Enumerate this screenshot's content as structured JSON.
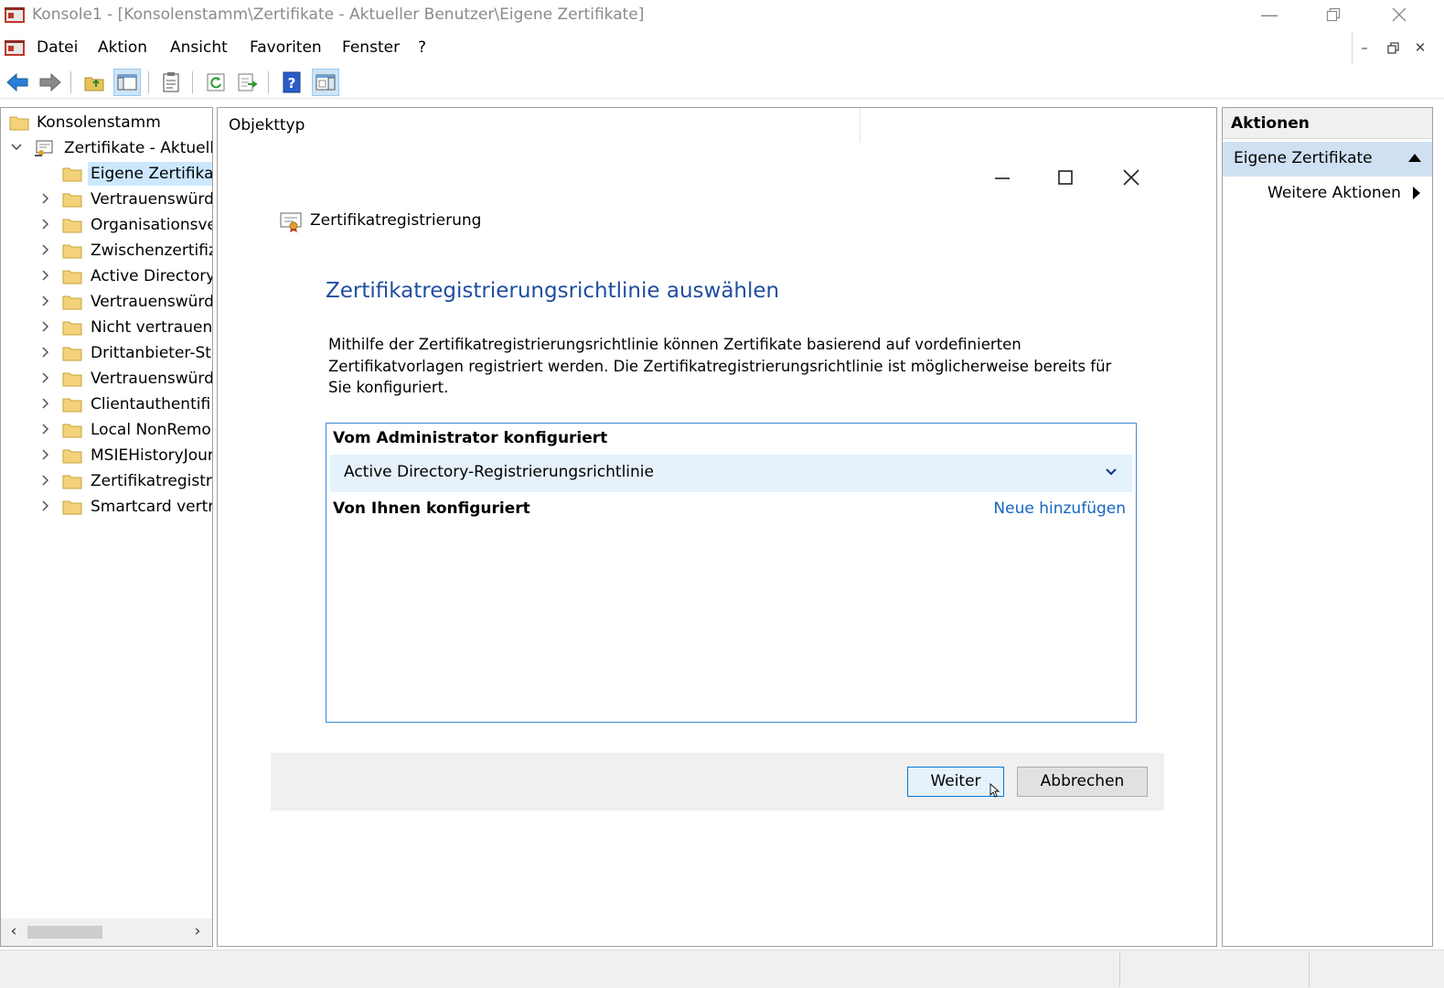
{
  "window": {
    "title": "Konsole1 - [Konsolenstamm\\Zertifikate - Aktueller Benutzer\\Eigene Zertifikate]"
  },
  "menu": {
    "items": [
      "Datei",
      "Aktion",
      "Ansicht",
      "Favoriten",
      "Fenster",
      "?"
    ]
  },
  "toolbar": {
    "buttons": [
      "back-arrow",
      "forward-arrow",
      "up-folder",
      "show-hide-tree",
      "properties",
      "refresh",
      "export-list",
      "help",
      "show-hide-action-pane"
    ]
  },
  "tree": {
    "root": "Konsolenstamm",
    "store": "Zertifikate - Aktuell",
    "items": [
      "Eigene Zertifikat",
      "Vertrauenswürdi",
      "Organisationsve",
      "Zwischenzertifiz",
      "Active Directory",
      "Vertrauenswürdi",
      "Nicht vertrauens",
      "Drittanbieter-Sta",
      "Vertrauenswürdi",
      "Clientauthentifi",
      "Local NonRemo",
      "MSIEHistoryJour",
      "Zertifikatregistri",
      "Smartcard vertra"
    ],
    "selected_index": 0
  },
  "center": {
    "column_header": "Objekttyp"
  },
  "wizard": {
    "title": "Zertifikatregistrierung",
    "heading": "Zertifikatregistrierungsrichtlinie auswählen",
    "description": "Mithilfe der Zertifikatregistrierungsrichtlinie können Zertifikate basierend auf vordefinierten Zertifikatvorlagen registriert werden. Die Zertifikatregistrierungsrichtlinie ist möglicherweise bereits für Sie konfiguriert.",
    "admin_configured_label": "Vom Administrator konfiguriert",
    "policy_item": "Active Directory-Registrierungsrichtlinie",
    "user_configured_label": "Von Ihnen konfiguriert",
    "add_new_link": "Neue hinzufügen",
    "next_button": "Weiter",
    "cancel_button": "Abbrechen"
  },
  "actions": {
    "header": "Aktionen",
    "group": "Eigene Zertifikate",
    "more_actions": "Weitere Aktionen"
  },
  "colors": {
    "heading_blue": "#1f4e9e",
    "link_blue": "#1565c0",
    "selection": "#cce8ff",
    "focus_border": "#3c8ad2"
  }
}
